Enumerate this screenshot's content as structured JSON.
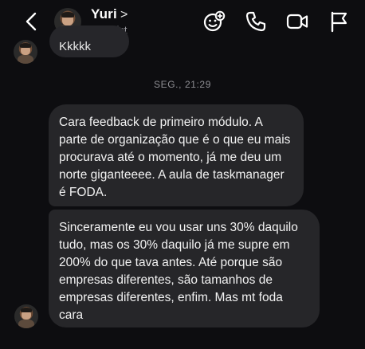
{
  "header": {
    "back_icon": "chevron-left-icon",
    "contact_name": "Yuri",
    "name_chevron": ">",
    "username": "__yurist",
    "actions": [
      "sticker-icon",
      "phone-icon",
      "video-camera-icon",
      "flag-icon"
    ]
  },
  "previous_message": {
    "text": "Kkkkk"
  },
  "timestamp": "SEG., 21:29",
  "messages": [
    {
      "text": "Cara feedback de primeiro módulo. A parte de organização que é o que eu mais procurava até o momento, já me deu um norte giganteeee. A aula de taskmanager é FODA."
    },
    {
      "text": "Sinceramente eu vou usar uns 30% daquilo tudo, mas os 30% daquilo já me supre em 200% do que tava antes. Até porque são empresas diferentes, são tamanhos de empresas diferentes, enfim. Mas mt foda cara"
    }
  ],
  "colors": {
    "background": "#0d0d10",
    "bubble": "#262629",
    "muted_text": "#8e8e93"
  }
}
